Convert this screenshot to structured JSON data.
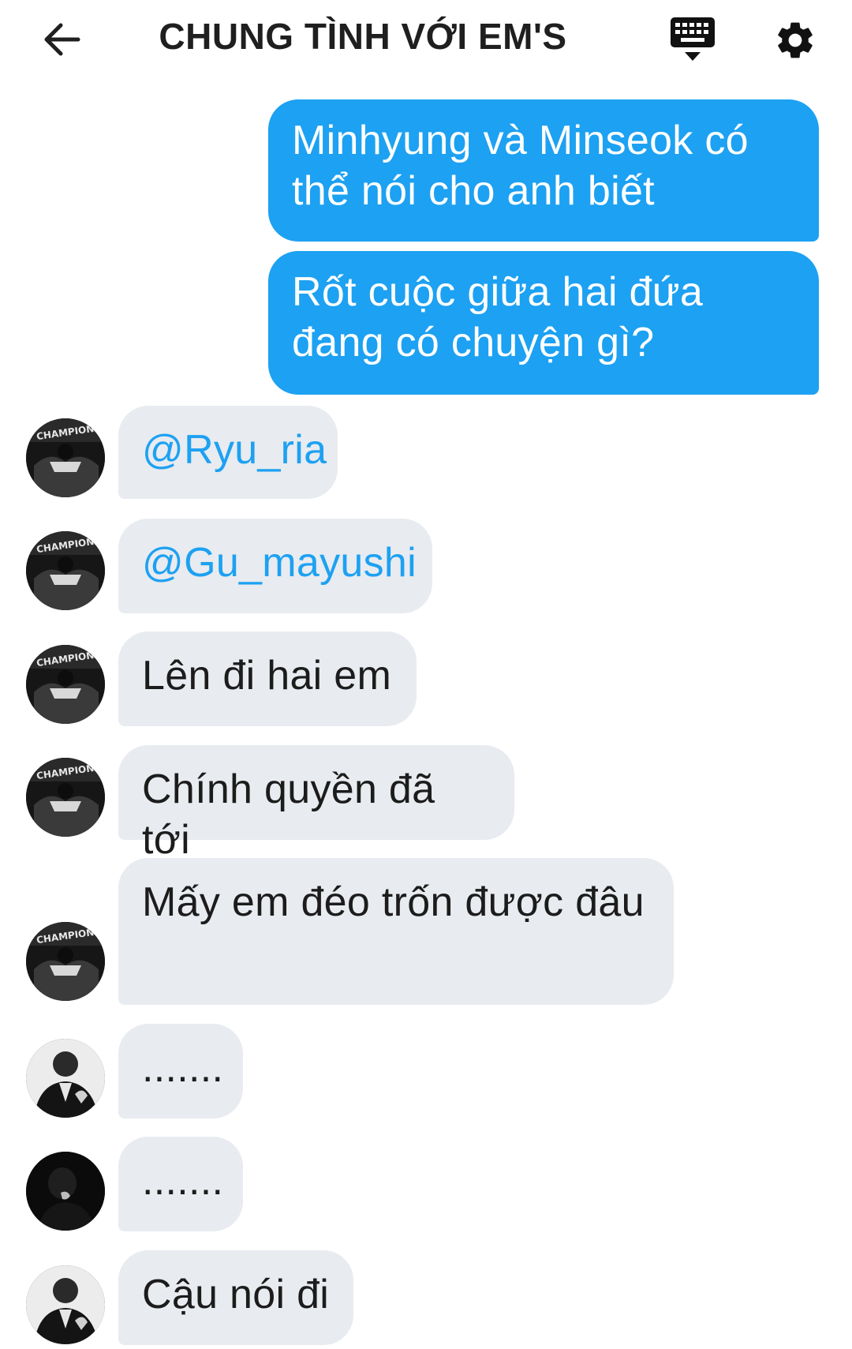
{
  "header": {
    "title": "CHUNG TÌNH VỚI EM'S",
    "back_icon": "arrow-left-icon",
    "keyboard_icon": "keyboard-icon",
    "settings_icon": "gear-icon"
  },
  "colors": {
    "outgoing_bubble": "#1da1f2",
    "incoming_bubble": "#e8ebef",
    "mention": "#1da1f2"
  },
  "messages": [
    {
      "direction": "outgoing",
      "text": "Minhyung và Minseok có thể nói cho anh biết"
    },
    {
      "direction": "outgoing",
      "text": "Rốt cuộc giữa hai đứa đang có chuyện gì?"
    },
    {
      "direction": "incoming",
      "avatar": "champion-avatar",
      "text": "@Ryu_ria"
    },
    {
      "direction": "incoming",
      "avatar": "champion-avatar",
      "text": "@Gu_mayushi"
    },
    {
      "direction": "incoming",
      "avatar": "champion-avatar",
      "text": "Lên đi hai em"
    },
    {
      "direction": "incoming",
      "avatar": "champion-avatar",
      "text": "Chính quyền đã tới"
    },
    {
      "direction": "incoming",
      "avatar": "champion-avatar",
      "text": "Mấy em đéo trốn được đâu"
    },
    {
      "direction": "incoming",
      "avatar": "suit-avatar",
      "text": "......."
    },
    {
      "direction": "incoming",
      "avatar": "dark-avatar",
      "text": "......."
    },
    {
      "direction": "incoming",
      "avatar": "suit-avatar",
      "text": "Cậu nói đi"
    }
  ]
}
